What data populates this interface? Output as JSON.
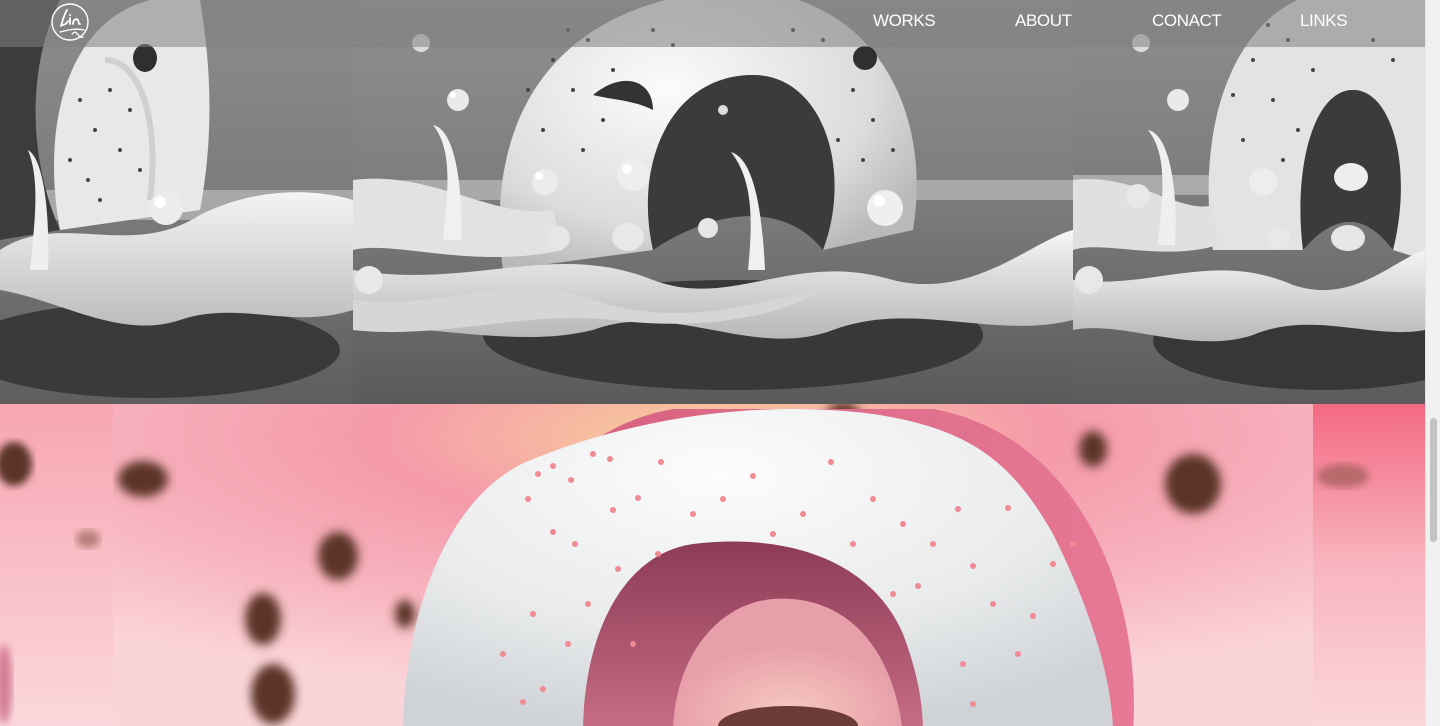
{
  "site": {
    "logo_icon": "lin-signature-logo-icon"
  },
  "nav": {
    "items": [
      {
        "label": "WORKS"
      },
      {
        "label": "ABOUT"
      },
      {
        "label": "CONACT"
      },
      {
        "label": "LINKS"
      }
    ]
  },
  "gallery": {
    "top_row": {
      "subject": "gray-milk-splash-donut-render"
    },
    "bottom_row": {
      "subject": "pink-glazed-donut-render"
    }
  },
  "colors": {
    "nav_bar": "#808080",
    "nav_text": "#ffffff",
    "gray_render_bg": "#7a7a7a",
    "pink_render_bg": "#f48fa0",
    "glaze": "#f2f2f2"
  },
  "scroll": {
    "position_fraction": 0.58
  }
}
